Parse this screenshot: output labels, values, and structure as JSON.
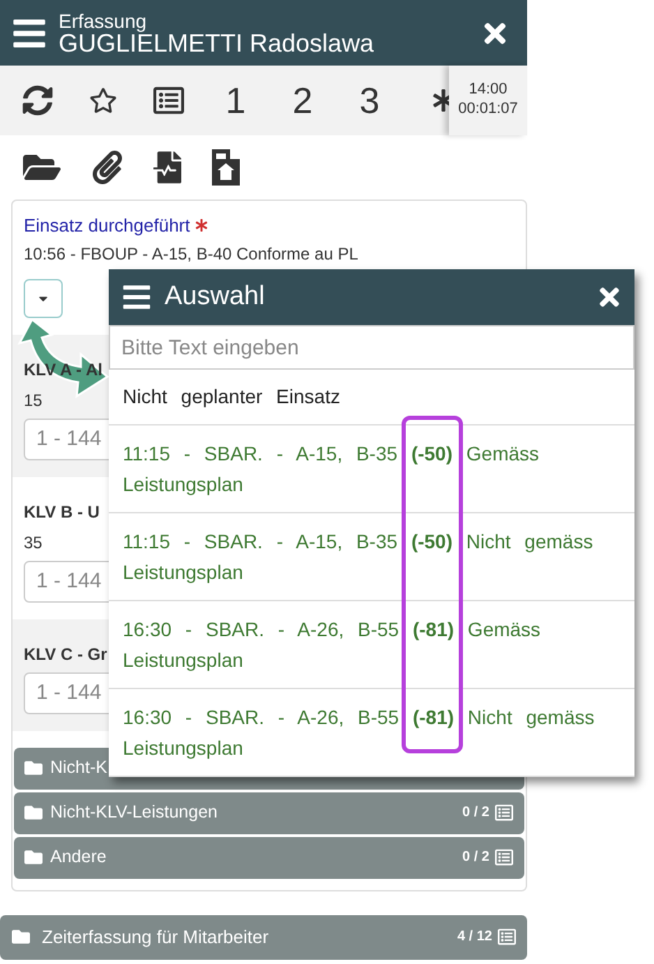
{
  "header": {
    "subtitle": "Erfassung",
    "title": "GUGLIELMETTI Radoslawa"
  },
  "toolbar": {
    "numbers": [
      "1",
      "2",
      "3"
    ],
    "time": "14:00",
    "duration": "00:01:07"
  },
  "form": {
    "label": "Einsatz durchgeführt",
    "required": true,
    "value": "10:56 - FBOUP - A-15, B-40 Conforme au PL",
    "fields": [
      {
        "label": "KLV A - Al",
        "value": "15",
        "placeholder": "1 - 144"
      },
      {
        "label": "KLV B - U",
        "value": "35",
        "placeholder": "1 - 144"
      },
      {
        "label": "KLV C - Gr",
        "placeholder": "1 - 144"
      }
    ]
  },
  "sections": [
    {
      "label": "Nicht-K"
    },
    {
      "label": "Nicht-KLV-Leistungen",
      "count": "0 / 2"
    },
    {
      "label": "Andere",
      "count": "0 / 2"
    }
  ],
  "footer_section": {
    "label": "Zeiterfassung für Mitarbeiter",
    "count": "4 / 12"
  },
  "popup": {
    "title": "Auswahl",
    "placeholder": "Bitte Text eingeben",
    "options": [
      {
        "kind": "plain",
        "text": "Nicht geplanter Einsatz"
      },
      {
        "kind": "planned",
        "text": "11:15 - SBAR. - A-15, B-35 **(-50)** Gemäss Leistungsplan"
      },
      {
        "kind": "planned",
        "text": "11:15 - SBAR. - A-15, B-35 **(-50)** Nicht gemäss Leistungsplan"
      },
      {
        "kind": "planned",
        "text": "16:30 - SBAR. - A-26, B-55 **(-81)** Gemäss Leistungsplan"
      },
      {
        "kind": "planned",
        "text": "16:30 - SBAR. - A-26, B-55 **(-81)** Nicht gemäss Leistungsplan"
      }
    ]
  }
}
